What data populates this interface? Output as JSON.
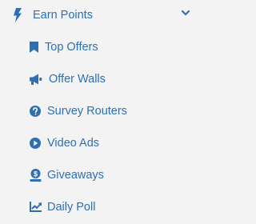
{
  "colors": {
    "background": "#f3f3f3",
    "accent": "#2f6fb0"
  },
  "section": {
    "title": "Earn Points",
    "icon": "bolt-icon",
    "toggle_icon": "chevron-down-icon"
  },
  "items": [
    {
      "label": "Top Offers",
      "icon": "bookmark-icon"
    },
    {
      "label": "Offer Walls",
      "icon": "megaphone-icon"
    },
    {
      "label": "Survey Routers",
      "icon": "question-circle-icon"
    },
    {
      "label": "Video Ads",
      "icon": "play-circle-icon"
    },
    {
      "label": "Giveaways",
      "icon": "gift-coin-icon"
    },
    {
      "label": "Daily Poll",
      "icon": "line-chart-icon"
    }
  ]
}
